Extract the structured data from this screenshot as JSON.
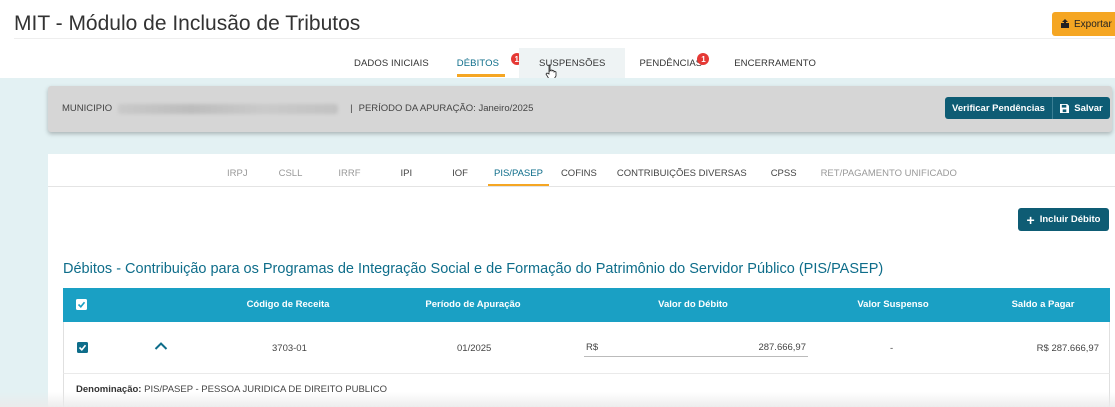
{
  "app": {
    "title": "MIT - Módulo de Inclusão de Tributos",
    "export_label": "Exportar"
  },
  "top_tabs": [
    {
      "label": "DADOS INICIAIS",
      "badge": ""
    },
    {
      "label": "DÉBITOS",
      "badge": "1"
    },
    {
      "label": "SUSPENSÕES",
      "badge": ""
    },
    {
      "label": "PENDÊNCIAS",
      "badge": "1"
    },
    {
      "label": "ENCERRAMENTO",
      "badge": ""
    }
  ],
  "info_bar": {
    "municipio_label": "MUNICIPIO",
    "separator": "|",
    "periodo_label": "PERÍODO DA APURAÇÃO: Janeiro/2025",
    "verify_label": "Verificar Pendências",
    "save_label": "Salvar"
  },
  "sub_tabs": [
    {
      "label": "IRPJ"
    },
    {
      "label": "CSLL"
    },
    {
      "label": "IRRF"
    },
    {
      "label": "IPI"
    },
    {
      "label": "IOF"
    },
    {
      "label": "PIS/PASEP"
    },
    {
      "label": "COFINS"
    },
    {
      "label": "CONTRIBUIÇÕES DIVERSAS"
    },
    {
      "label": "CPSS"
    },
    {
      "label": "RET/PAGAMENTO UNIFICADO"
    }
  ],
  "add_button_label": "Incluir Débito",
  "section_title": "Débitos - Contribuição para os Programas de Integração Social e de Formação do Patrimônio do Servidor Público (PIS/PASEP)",
  "table": {
    "headers": {
      "codigo": "Código de Receita",
      "periodo": "Período de Apuração",
      "valor": "Valor do Débito",
      "suspenso": "Valor Suspenso",
      "saldo": "Saldo a Pagar"
    },
    "rows": [
      {
        "codigo": "3703-01",
        "periodo": "01/2025",
        "currency": "R$",
        "valor": "287.666,97",
        "suspenso": "-",
        "saldo": "R$ 287.666,97"
      }
    ],
    "detail": {
      "label": "Denominação:",
      "value": "PIS/PASEP - PESSOA JURIDICA DE DIREITO PUBLICO"
    }
  },
  "colors": {
    "primary": "#0e5c74",
    "table_header": "#1aa0c4",
    "accent": "#f5a623",
    "badge": "#e53935",
    "background": "#e3f1f3"
  }
}
